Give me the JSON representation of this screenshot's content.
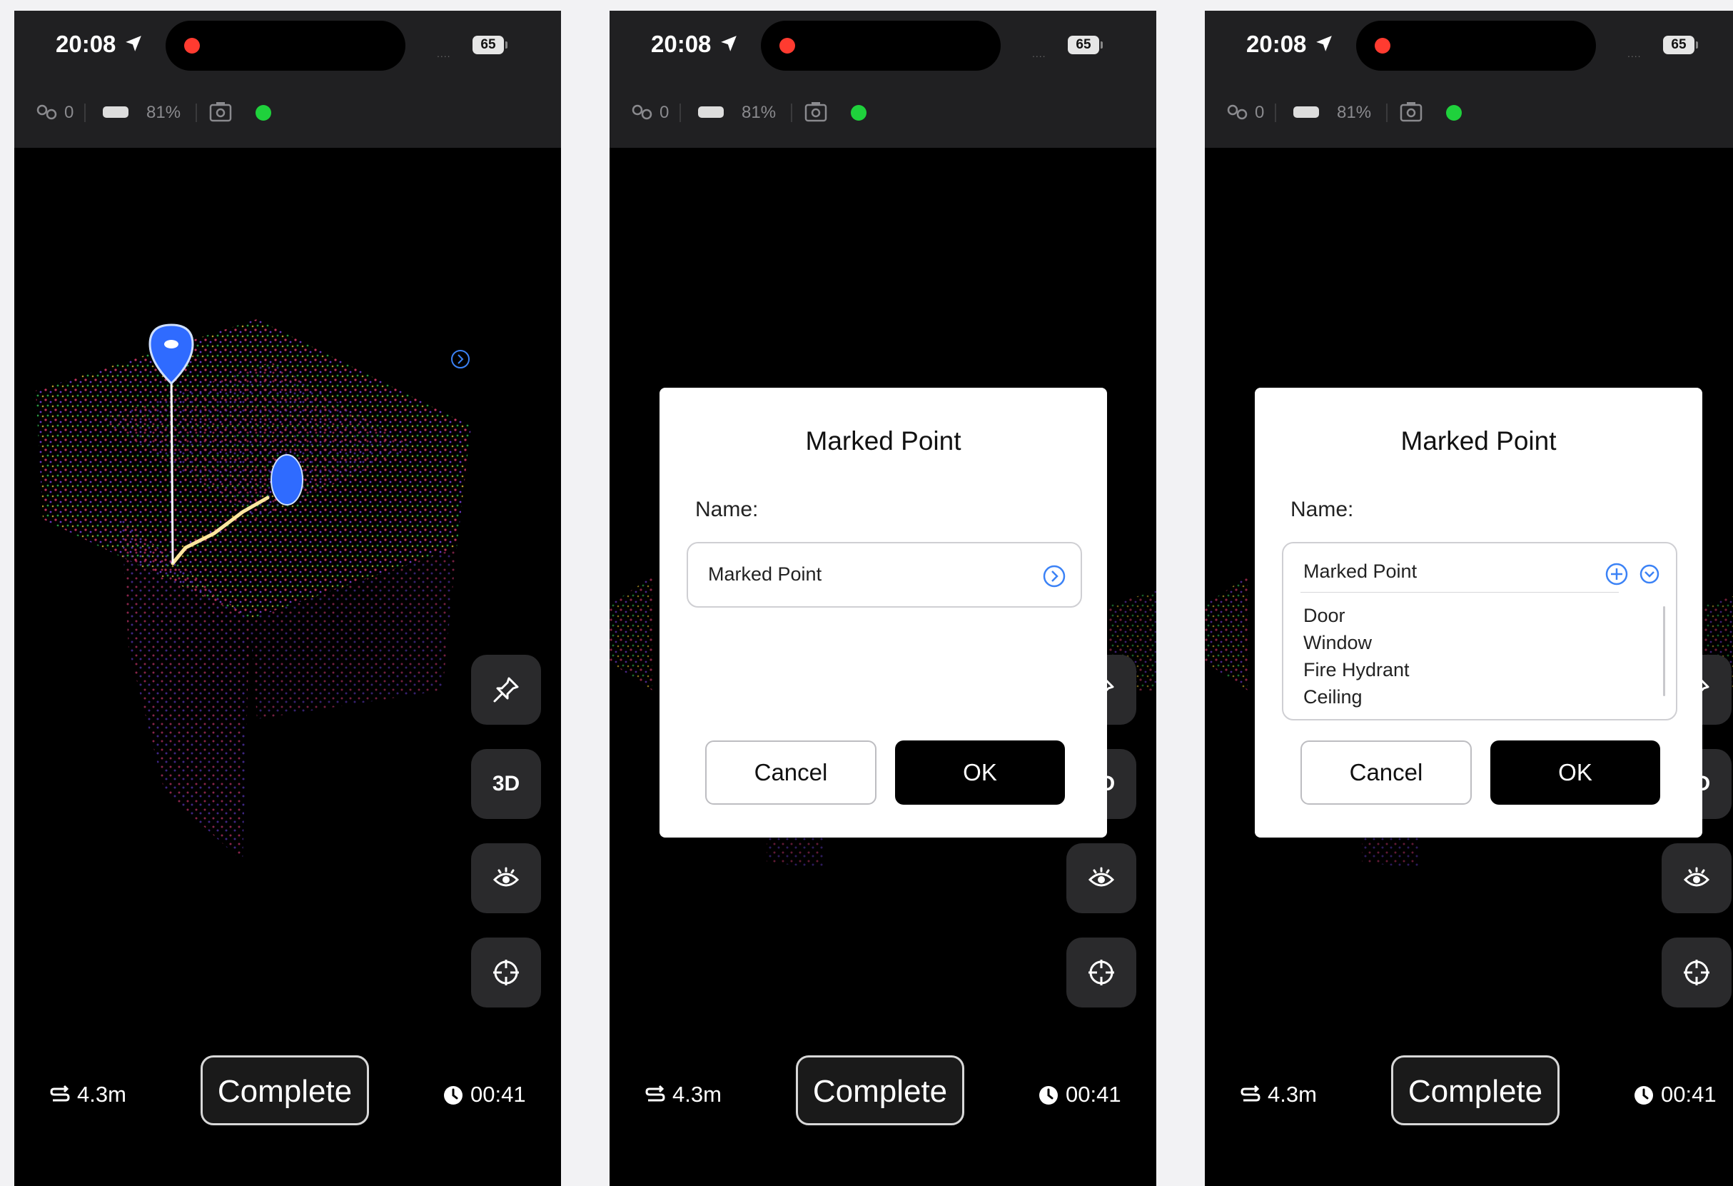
{
  "status_bar": {
    "time": "20:08",
    "battery_level": "65"
  },
  "toolbar": {
    "link_count": "0",
    "device_battery": "81%",
    "status_color": "#1fd13c"
  },
  "side_buttons": {
    "mode_label": "3D"
  },
  "bottom": {
    "distance": "4.3m",
    "complete_label": "Complete",
    "timer": "00:41"
  },
  "dialog": {
    "title": "Marked Point",
    "name_label": "Name:",
    "name_value": "Marked Point",
    "cancel_label": "Cancel",
    "ok_label": "OK"
  },
  "dropdown": {
    "options": [
      "Door",
      "Window",
      "Fire Hydrant",
      "Ceiling"
    ]
  },
  "colors": {
    "accent": "#3b82f6",
    "record": "#ff3b30"
  }
}
